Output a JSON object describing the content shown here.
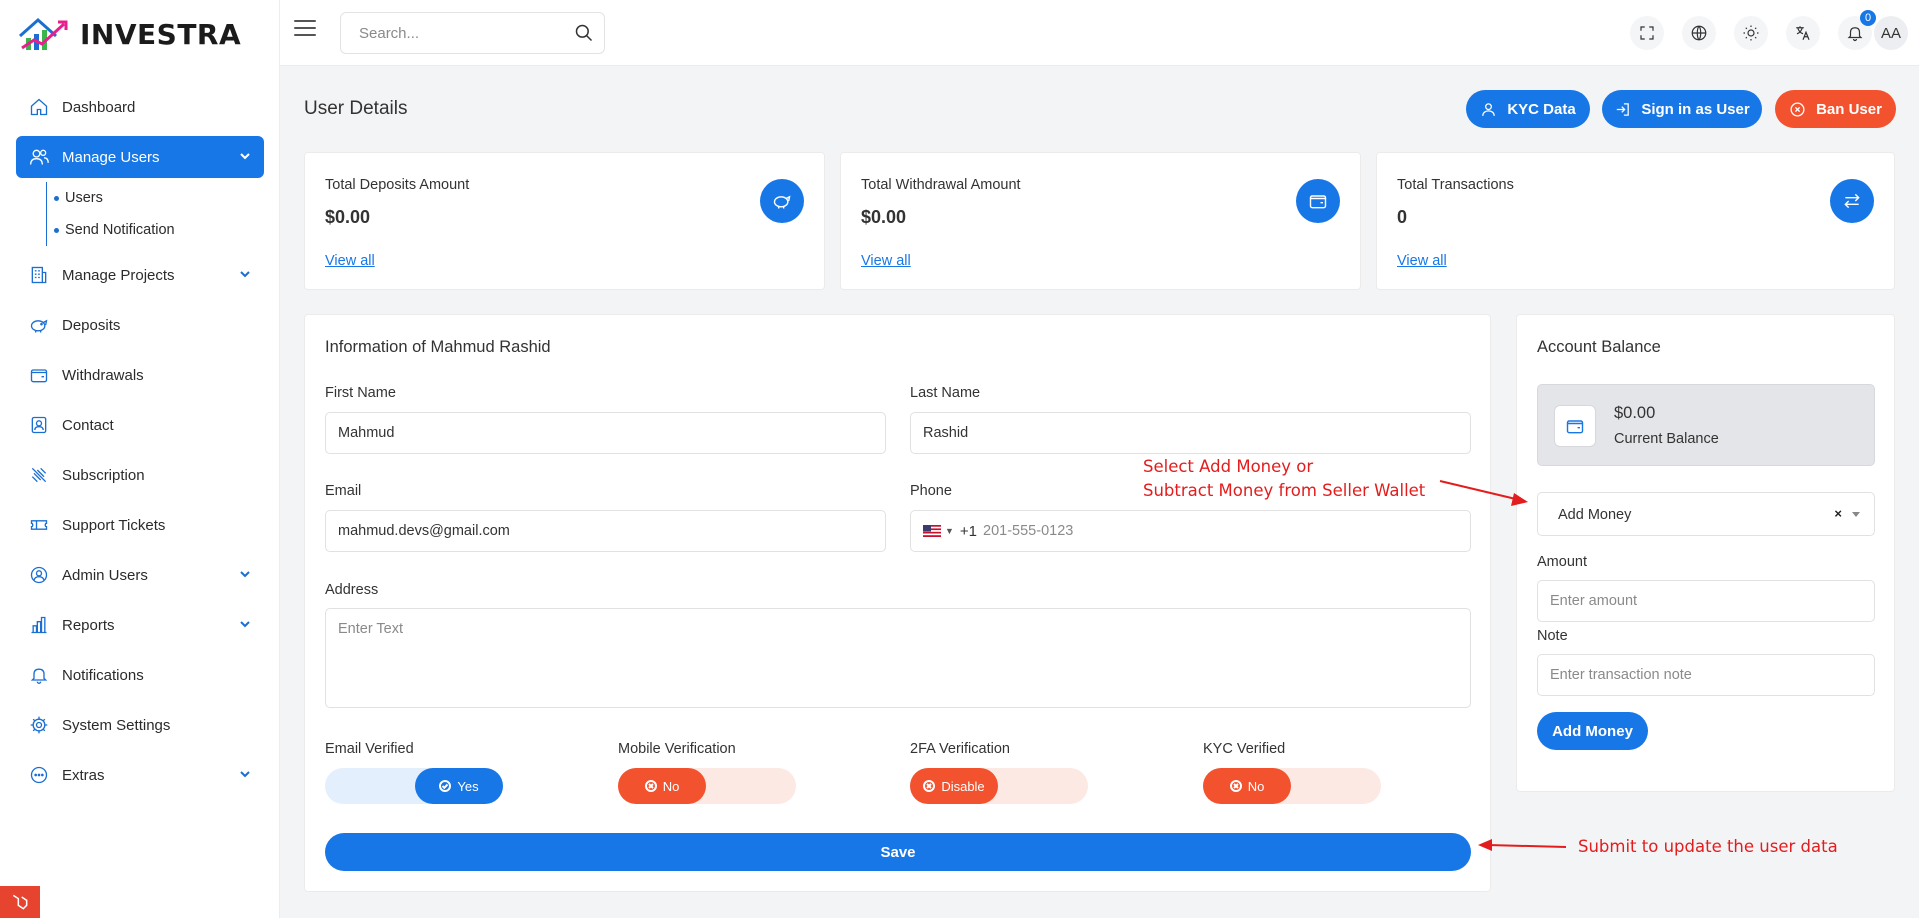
{
  "brand": {
    "name": "INVESTRA"
  },
  "search": {
    "placeholder": "Search..."
  },
  "notifications": {
    "count": "0"
  },
  "user": {
    "initials": "AA"
  },
  "sidebar": {
    "items": [
      {
        "label": "Dashboard",
        "icon": "home-icon"
      },
      {
        "label": "Manage Users",
        "icon": "users-icon",
        "active": true
      },
      {
        "label": "Manage Projects",
        "icon": "building-icon"
      },
      {
        "label": "Deposits",
        "icon": "piggy-bank-icon"
      },
      {
        "label": "Withdrawals",
        "icon": "wallet-icon"
      },
      {
        "label": "Contact",
        "icon": "contact-icon"
      },
      {
        "label": "Subscription",
        "icon": "subscription-icon"
      },
      {
        "label": "Support Tickets",
        "icon": "ticket-icon"
      },
      {
        "label": "Admin Users",
        "icon": "user-circle-icon"
      },
      {
        "label": "Reports",
        "icon": "chart-icon"
      },
      {
        "label": "Notifications",
        "icon": "bell-icon"
      },
      {
        "label": "System Settings",
        "icon": "gear-icon"
      },
      {
        "label": "Extras",
        "icon": "dots-icon"
      }
    ],
    "subitems": [
      "Users",
      "Send Notification"
    ]
  },
  "header": {
    "title": "User Details",
    "kyc_label": "KYC Data",
    "signin_label": "Sign in as User",
    "ban_label": "Ban User"
  },
  "stats": [
    {
      "label": "Total Deposits Amount",
      "value": "$0.00",
      "link": "View all"
    },
    {
      "label": "Total Withdrawal Amount",
      "value": "$0.00",
      "link": "View all"
    },
    {
      "label": "Total Transactions",
      "value": "0",
      "link": "View all"
    }
  ],
  "info": {
    "title": "Information of Mahmud Rashid",
    "first_name_label": "First Name",
    "first_name": "Mahmud",
    "last_name_label": "Last Name",
    "last_name": "Rashid",
    "email_label": "Email",
    "email": "mahmud.devs@gmail.com",
    "phone_label": "Phone",
    "phone_code": "+1",
    "phone_placeholder": "201-555-0123",
    "address_label": "Address",
    "address_placeholder": "Enter Text",
    "toggles": [
      {
        "label": "Email Verified",
        "state": "Yes"
      },
      {
        "label": "Mobile Verification",
        "state": "No"
      },
      {
        "label": "2FA Verification",
        "state": "Disable"
      },
      {
        "label": "KYC Verified",
        "state": "No"
      }
    ],
    "save_label": "Save"
  },
  "balance": {
    "title": "Account Balance",
    "amount": "$0.00",
    "caption": "Current Balance",
    "type_selected": "Add Money",
    "clear": "×",
    "amount_label": "Amount",
    "amount_placeholder": "Enter amount",
    "note_label": "Note",
    "note_placeholder": "Enter transaction note",
    "submit_label": "Add Money"
  },
  "annotations": {
    "select_line1": "Select Add Money or",
    "select_line2": "Subtract Money from Seller Wallet",
    "submit": "Submit to update the user data"
  },
  "colors": {
    "primary": "#1877e6",
    "danger": "#f2522e",
    "annotation": "#e31d1d"
  }
}
